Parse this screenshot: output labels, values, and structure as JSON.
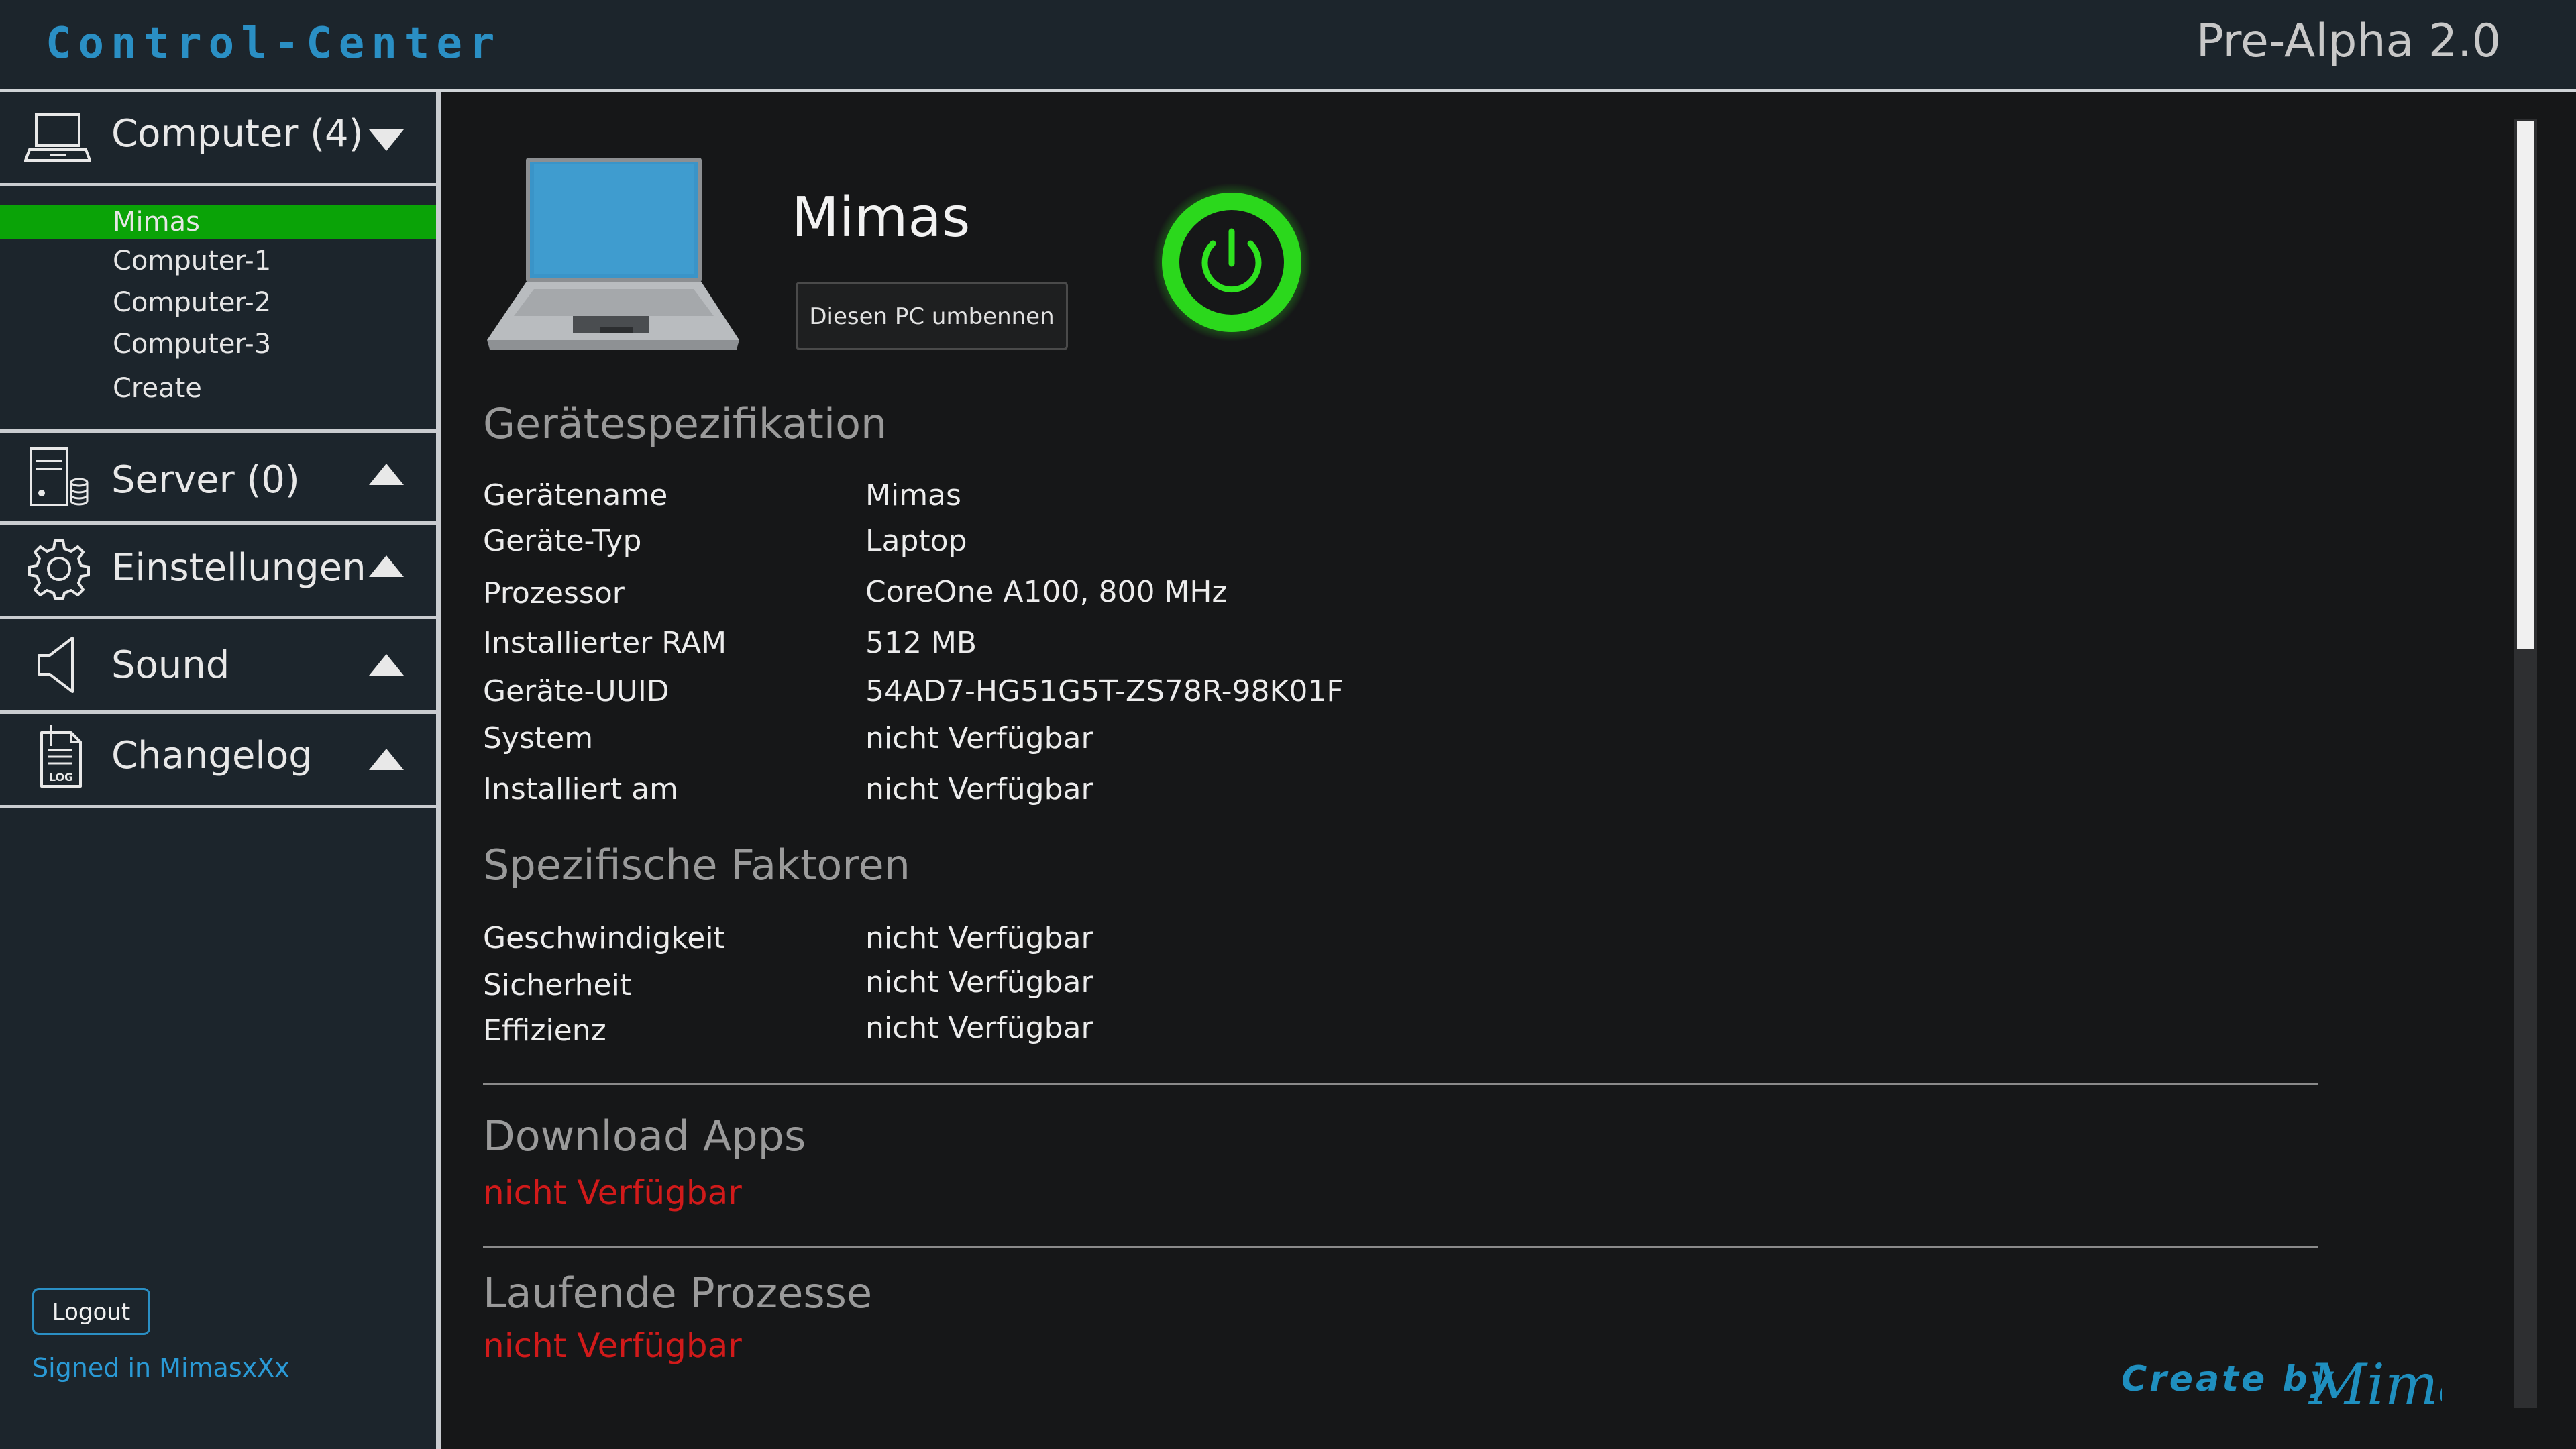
{
  "header": {
    "brand": "Control-Center",
    "version": "Pre-Alpha 2.0"
  },
  "sidebar": {
    "sections": [
      {
        "label": "Computer (4)",
        "icon": "laptop-icon",
        "expanded": true
      },
      {
        "label": "Server (0)",
        "icon": "server-icon",
        "expanded": false
      },
      {
        "label": "Einstellungen",
        "icon": "gear-icon",
        "expanded": false
      },
      {
        "label": "Sound",
        "icon": "speaker-icon",
        "expanded": false
      },
      {
        "label": "Changelog",
        "icon": "log-icon",
        "expanded": false
      }
    ],
    "computers": [
      "Mimas",
      "Computer-1",
      "Computer-2",
      "Computer-3",
      "Create"
    ],
    "active_computer": "Mimas",
    "logout_label": "Logout",
    "signed_in": "Signed in MimasxXx"
  },
  "main": {
    "pc_name": "Mimas",
    "rename_label": "Diesen PC umbennen",
    "power_state": "on",
    "spec_title": "Gerätespezifikation",
    "specs": [
      {
        "label": "Gerätename",
        "value": "Mimas"
      },
      {
        "label": "Geräte-Typ",
        "value": "Laptop"
      },
      {
        "label": "Prozessor",
        "value": "CoreOne A100, 800 MHz"
      },
      {
        "label": "Installierter RAM",
        "value": "512 MB"
      },
      {
        "label": "Geräte-UUID",
        "value": "54AD7-HG51G5T-ZS78R-98K01F"
      },
      {
        "label": "System",
        "value": "nicht Verfügbar"
      },
      {
        "label": "Installiert am",
        "value": "nicht Verfügbar"
      }
    ],
    "factors_title": "Spezifische Faktoren",
    "factors": [
      {
        "label": "Geschwindigkeit",
        "value": "nicht Verfügbar"
      },
      {
        "label": "Sicherheit",
        "value": "nicht Verfügbar"
      },
      {
        "label": "Effizienz",
        "value": "nicht Verfügbar"
      }
    ],
    "download_title": "Download Apps",
    "download_value": "nicht Verfügbar",
    "processes_title": "Laufende Prozesse",
    "processes_value": "nicht Verfügbar",
    "credit_prefix": "Create by",
    "credit_name": "Mimas"
  },
  "colors": {
    "accent_blue": "#2a8fc4",
    "active_green": "#0aa307",
    "power_green": "#2ee31f",
    "error_red": "#d11a1a"
  }
}
